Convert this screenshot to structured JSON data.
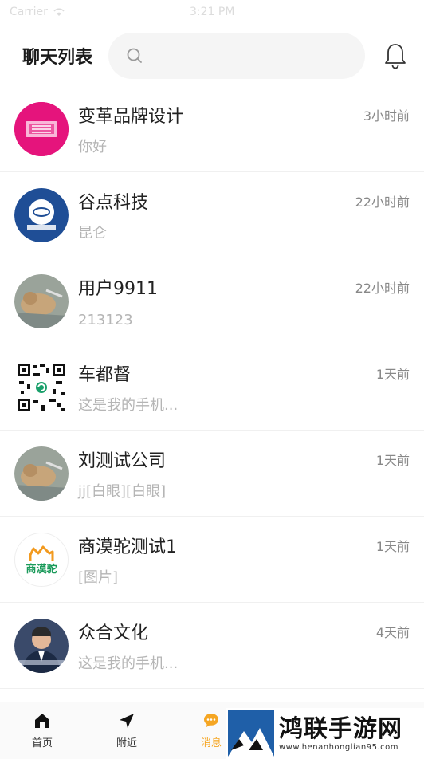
{
  "status_bar": {
    "carrier": "Carrier",
    "time": "3:21 PM"
  },
  "header": {
    "title": "聊天列表",
    "search_placeholder": ""
  },
  "chats": [
    {
      "name": "变革品牌设计",
      "message": "你好",
      "time": "3小时前",
      "avatar": "pink-logo"
    },
    {
      "name": "谷点科技",
      "message": "昆仑",
      "time": "22小时前",
      "avatar": "blue-badge"
    },
    {
      "name": "用户9911",
      "message": "213123",
      "time": "22小时前",
      "avatar": "cat-photo"
    },
    {
      "name": "车都督",
      "message": "这是我的手机...",
      "time": "1天前",
      "avatar": "qr-code"
    },
    {
      "name": "刘测试公司",
      "message": "jj[白眼][白眼]",
      "time": "1天前",
      "avatar": "cat-photo"
    },
    {
      "name": "商漠驼测试1",
      "message": "[图片]",
      "time": "1天前",
      "avatar": "camel-logo",
      "avatar_text": "商漠驼"
    },
    {
      "name": "众合文化",
      "message": "这是我的手机...",
      "time": "4天前",
      "avatar": "person-photo"
    }
  ],
  "tabbar": [
    {
      "label": "首页",
      "icon": "home-icon",
      "active": false
    },
    {
      "label": "附近",
      "icon": "location-arrow-icon",
      "active": false
    },
    {
      "label": "消息",
      "icon": "chat-bubble-icon",
      "active": true
    }
  ],
  "watermark": {
    "title": "鸿联手游网",
    "url": "www.henanhonglian95.com"
  },
  "colors": {
    "accent": "#f5a623",
    "muted_text": "#b5b5b5",
    "search_bg": "#f5f5f5"
  }
}
